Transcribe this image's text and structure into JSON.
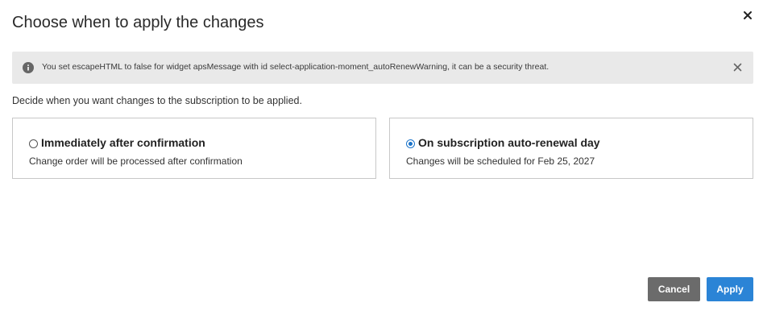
{
  "dialog": {
    "title": "Choose when to apply the changes",
    "close_icon": "close-icon"
  },
  "alert": {
    "icon": "info-icon",
    "message": "You set escapeHTML to false for widget apsMessage with id select-application-moment_autoRenewWarning, it can be a security threat.",
    "dismiss_icon": "close-icon"
  },
  "prompt": "Decide when you want changes to the subscription to be applied.",
  "options": [
    {
      "title": "Immediately after confirmation",
      "description": "Change order will be processed after confirmation",
      "selected": false
    },
    {
      "title": "On subscription auto-renewal day",
      "description": "Changes will be scheduled for Feb 25, 2027",
      "selected": true
    }
  ],
  "buttons": {
    "cancel_label": "Cancel",
    "apply_label": "Apply"
  },
  "colors": {
    "accent": "#2b84d6",
    "cancel": "#6b6b6b",
    "alert_bg": "#e9e9e9"
  }
}
